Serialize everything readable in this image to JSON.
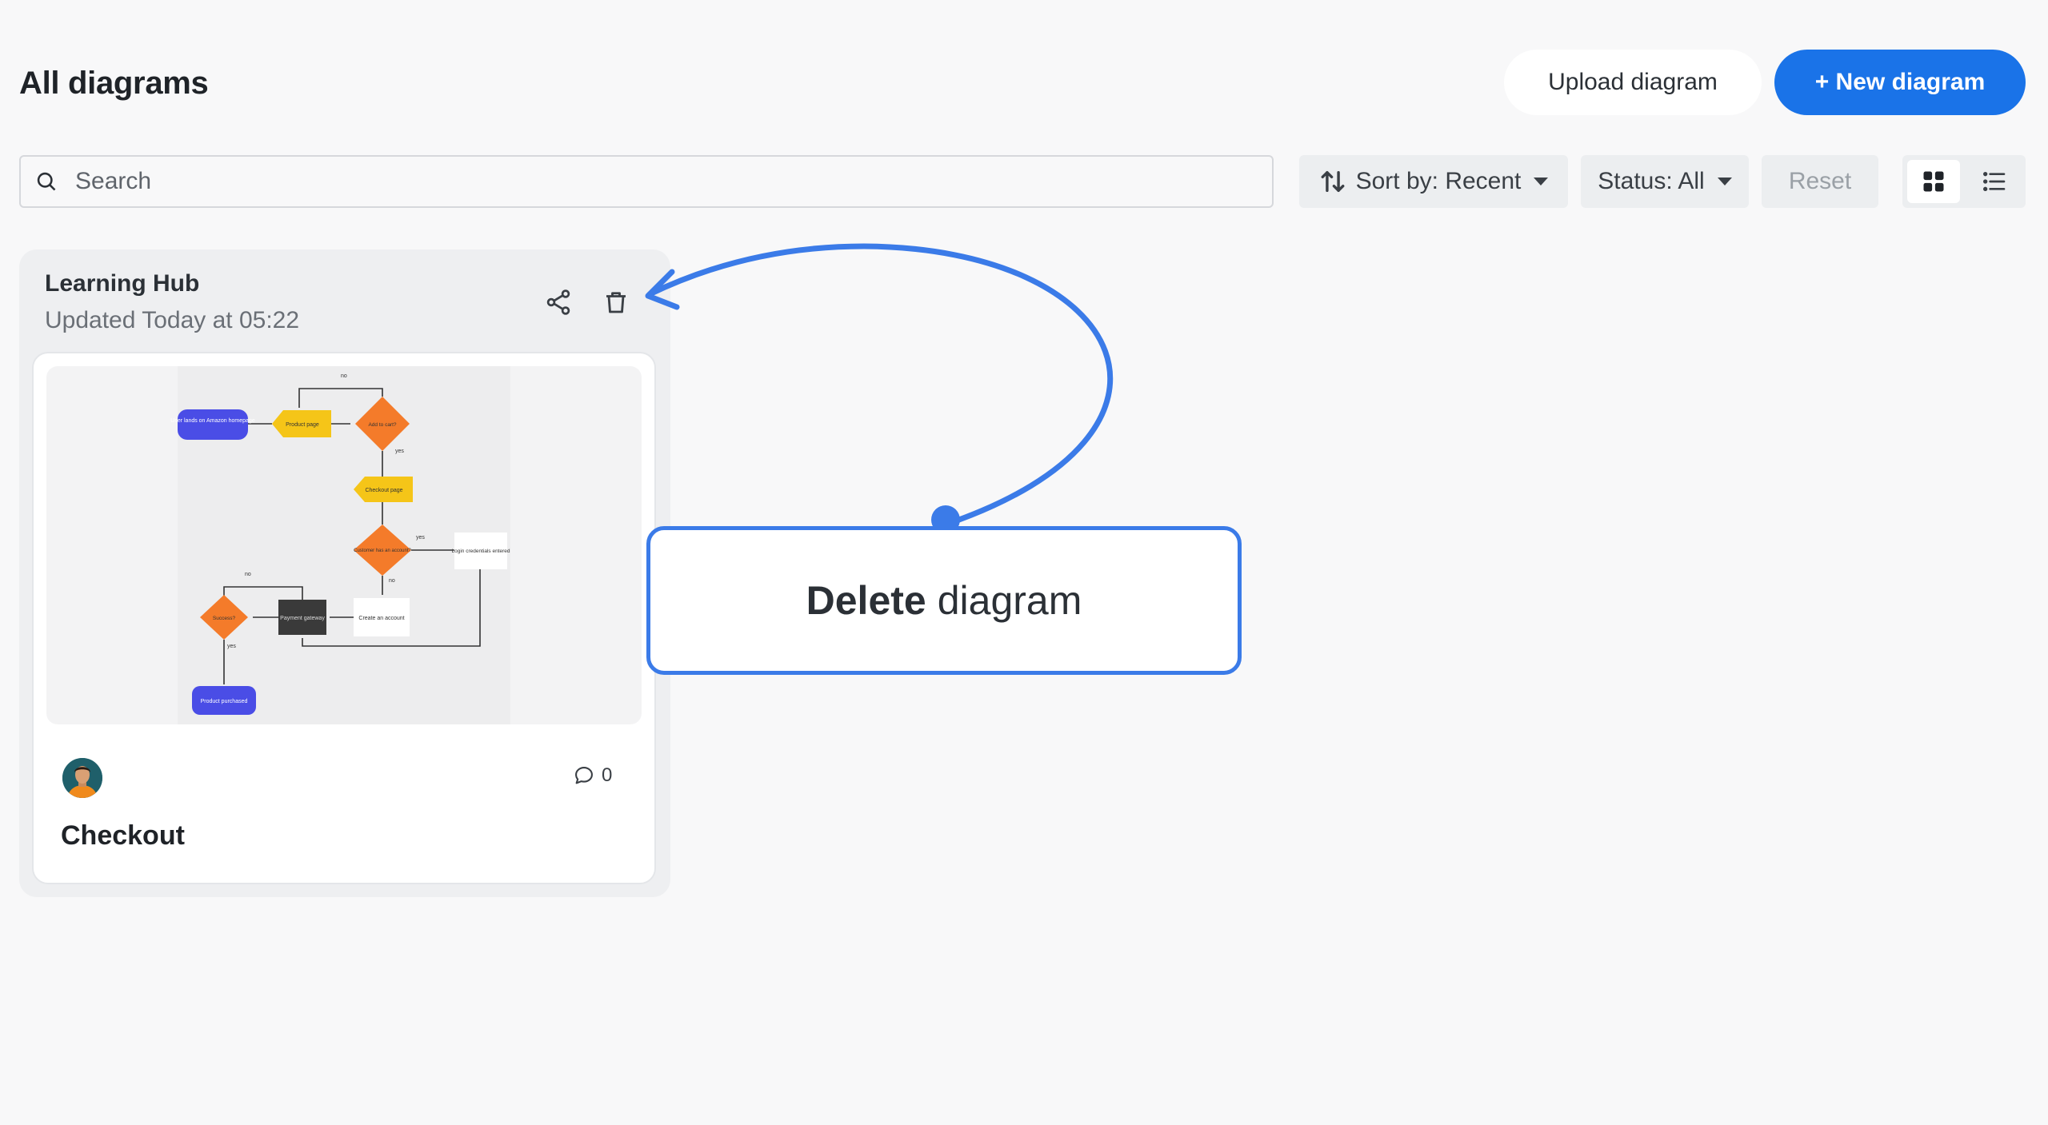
{
  "header": {
    "title": "All diagrams",
    "upload_label": "Upload diagram",
    "new_label": "+ New diagram"
  },
  "toolbar": {
    "search_placeholder": "Search",
    "sort_label": "Sort by: Recent",
    "status_label": "Status: All",
    "reset_label": "Reset",
    "view_mode": "grid"
  },
  "card": {
    "project": "Learning Hub",
    "updated": "Updated Today at 05:22",
    "title": "Checkout",
    "comment_count": "0",
    "thumbnail": {
      "nodes": {
        "start": "User lands on Amazon homepage",
        "product": "Product page",
        "cart": "Add to cart?",
        "checkout": "Checkout page",
        "customer": "Customer has an account?",
        "login": "Login credentials entered",
        "create": "Create an account",
        "payment": "Payment gateway",
        "success": "Success?",
        "end": "Product purchased"
      },
      "edge_labels": {
        "no": "no",
        "yes": "yes"
      }
    }
  },
  "annotation": {
    "bold": "Delete",
    "rest": "diagram"
  },
  "colors": {
    "accent": "#1a73e8",
    "annotation": "#3b7be8",
    "flow_blue": "#4a4de6",
    "flow_yellow": "#f5c518",
    "flow_orange": "#f47b2a",
    "flow_dark": "#3a3a3a"
  }
}
